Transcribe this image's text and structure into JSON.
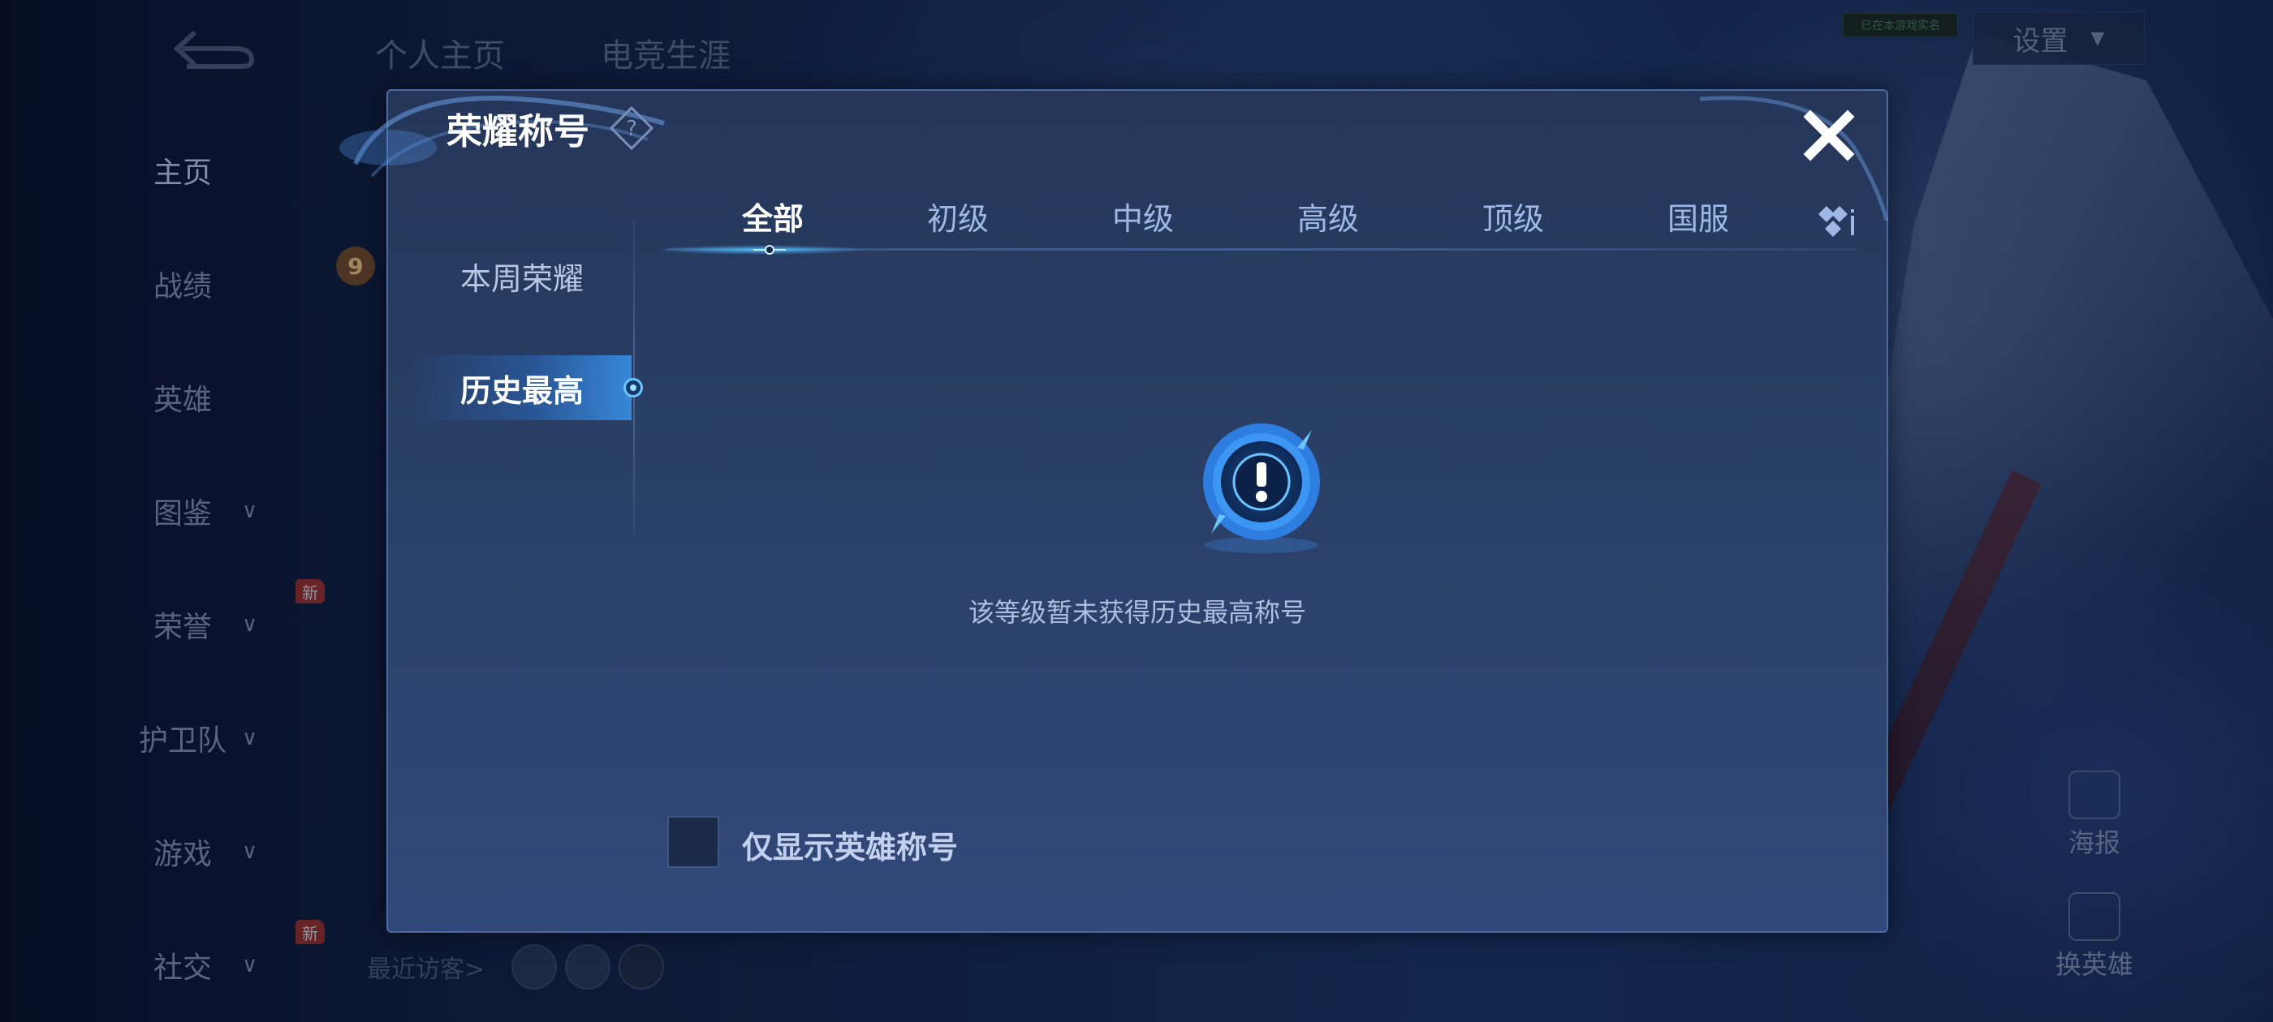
{
  "background": {
    "top_tabs": [
      {
        "label": "个人主页"
      },
      {
        "label": "电竞生涯"
      }
    ],
    "settings_label": "设置",
    "tiny_tag": "已在本游戏实名",
    "visitors_label": "最近访客>",
    "right_buttons": [
      {
        "label": "海报",
        "icon": "poster-icon"
      },
      {
        "label": "换英雄",
        "icon": "switch-hero-icon"
      }
    ]
  },
  "left_nav": {
    "items": [
      {
        "label": "主页",
        "active": true,
        "chevron": false,
        "badge": ""
      },
      {
        "label": "战绩",
        "active": false,
        "chevron": false,
        "badge": ""
      },
      {
        "label": "英雄",
        "active": false,
        "chevron": false,
        "badge": ""
      },
      {
        "label": "图鉴",
        "active": false,
        "chevron": true,
        "badge": ""
      },
      {
        "label": "荣誉",
        "active": false,
        "chevron": true,
        "badge": "新"
      },
      {
        "label": "护卫队",
        "active": false,
        "chevron": true,
        "badge": ""
      },
      {
        "label": "游戏",
        "active": false,
        "chevron": true,
        "badge": ""
      },
      {
        "label": "社交",
        "active": false,
        "chevron": true,
        "badge": "新"
      }
    ],
    "level_badge": "9"
  },
  "dialog": {
    "title": "荣耀称号",
    "help_icon": "question-diamond-icon",
    "close_icon": "close-icon",
    "side_items": [
      {
        "label": "本周荣耀",
        "active": false
      },
      {
        "label": "历史最高",
        "active": true
      }
    ],
    "tabs": [
      {
        "label": "全部",
        "active": true
      },
      {
        "label": "初级",
        "active": false
      },
      {
        "label": "中级",
        "active": false
      },
      {
        "label": "高级",
        "active": false
      },
      {
        "label": "顶级",
        "active": false
      },
      {
        "label": "国服",
        "active": false
      }
    ],
    "tab_more_icon": "diamond-cluster-icon",
    "empty_icon": "exclamation-badge-icon",
    "empty_message": "该等级暂未获得历史最高称号",
    "checkbox": {
      "label": "仅显示英雄称号",
      "checked": false
    }
  },
  "colors": {
    "dialog_bg": "#2a3f66",
    "accent": "#4fb6ff",
    "title_text": "#ffffff",
    "tab_text": "#9fb8e6"
  }
}
